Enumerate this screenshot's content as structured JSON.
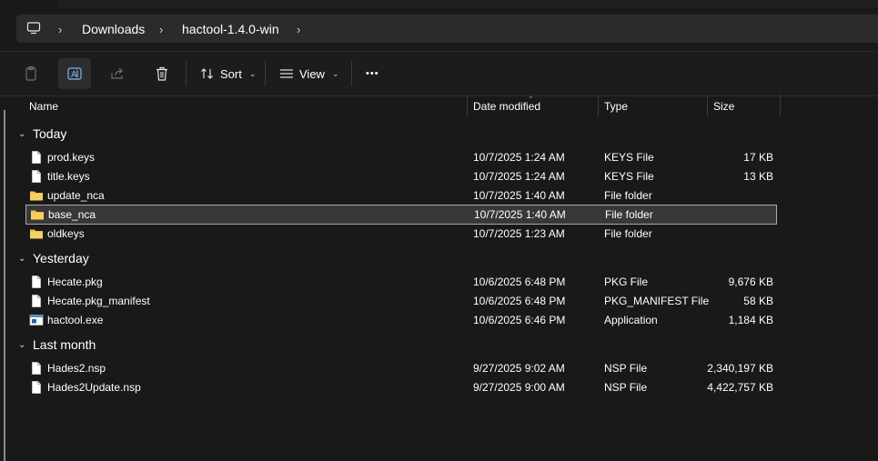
{
  "breadcrumb": [
    "Downloads",
    "hactool-1.4.0-win"
  ],
  "toolbar": {
    "sort_label": "Sort",
    "view_label": "View",
    "more_label": "•••"
  },
  "columns": {
    "name": "Name",
    "date": "Date modified",
    "type": "Type",
    "size": "Size"
  },
  "groups": [
    {
      "label": "Today"
    },
    {
      "label": "Yesterday"
    },
    {
      "label": "Last month"
    }
  ],
  "files": [
    {
      "name": "prod.keys",
      "date": "10/7/2025 1:24 AM",
      "type": "KEYS File",
      "size": "17 KB",
      "icon": "file-icon"
    },
    {
      "name": "title.keys",
      "date": "10/7/2025 1:24 AM",
      "type": "KEYS File",
      "size": "13 KB",
      "icon": "file-icon"
    },
    {
      "name": "update_nca",
      "date": "10/7/2025 1:40 AM",
      "type": "File folder",
      "size": "",
      "icon": "folder-icon"
    },
    {
      "name": "base_nca",
      "date": "10/7/2025 1:40 AM",
      "type": "File folder",
      "size": "",
      "icon": "folder-icon",
      "selected": true
    },
    {
      "name": "oldkeys",
      "date": "10/7/2025 1:23 AM",
      "type": "File folder",
      "size": "",
      "icon": "folder-icon"
    },
    {
      "name": "Hecate.pkg",
      "date": "10/6/2025 6:48 PM",
      "type": "PKG File",
      "size": "9,676 KB",
      "icon": "file-icon"
    },
    {
      "name": "Hecate.pkg_manifest",
      "date": "10/6/2025 6:48 PM",
      "type": "PKG_MANIFEST File",
      "size": "58 KB",
      "icon": "file-icon"
    },
    {
      "name": "hactool.exe",
      "date": "10/6/2025 6:46 PM",
      "type": "Application",
      "size": "1,184 KB",
      "icon": "application-icon"
    },
    {
      "name": "Hades2.nsp",
      "date": "9/27/2025 9:02 AM",
      "type": "NSP File",
      "size": "2,340,197 KB",
      "icon": "file-icon"
    },
    {
      "name": "Hades2Update.nsp",
      "date": "9/27/2025 9:00 AM",
      "type": "NSP File",
      "size": "4,422,757 KB",
      "icon": "file-icon"
    }
  ],
  "colors": {
    "folder": "#f0c14b",
    "selection_border": "#a8a8a8",
    "accent": "#4c8ed9"
  }
}
